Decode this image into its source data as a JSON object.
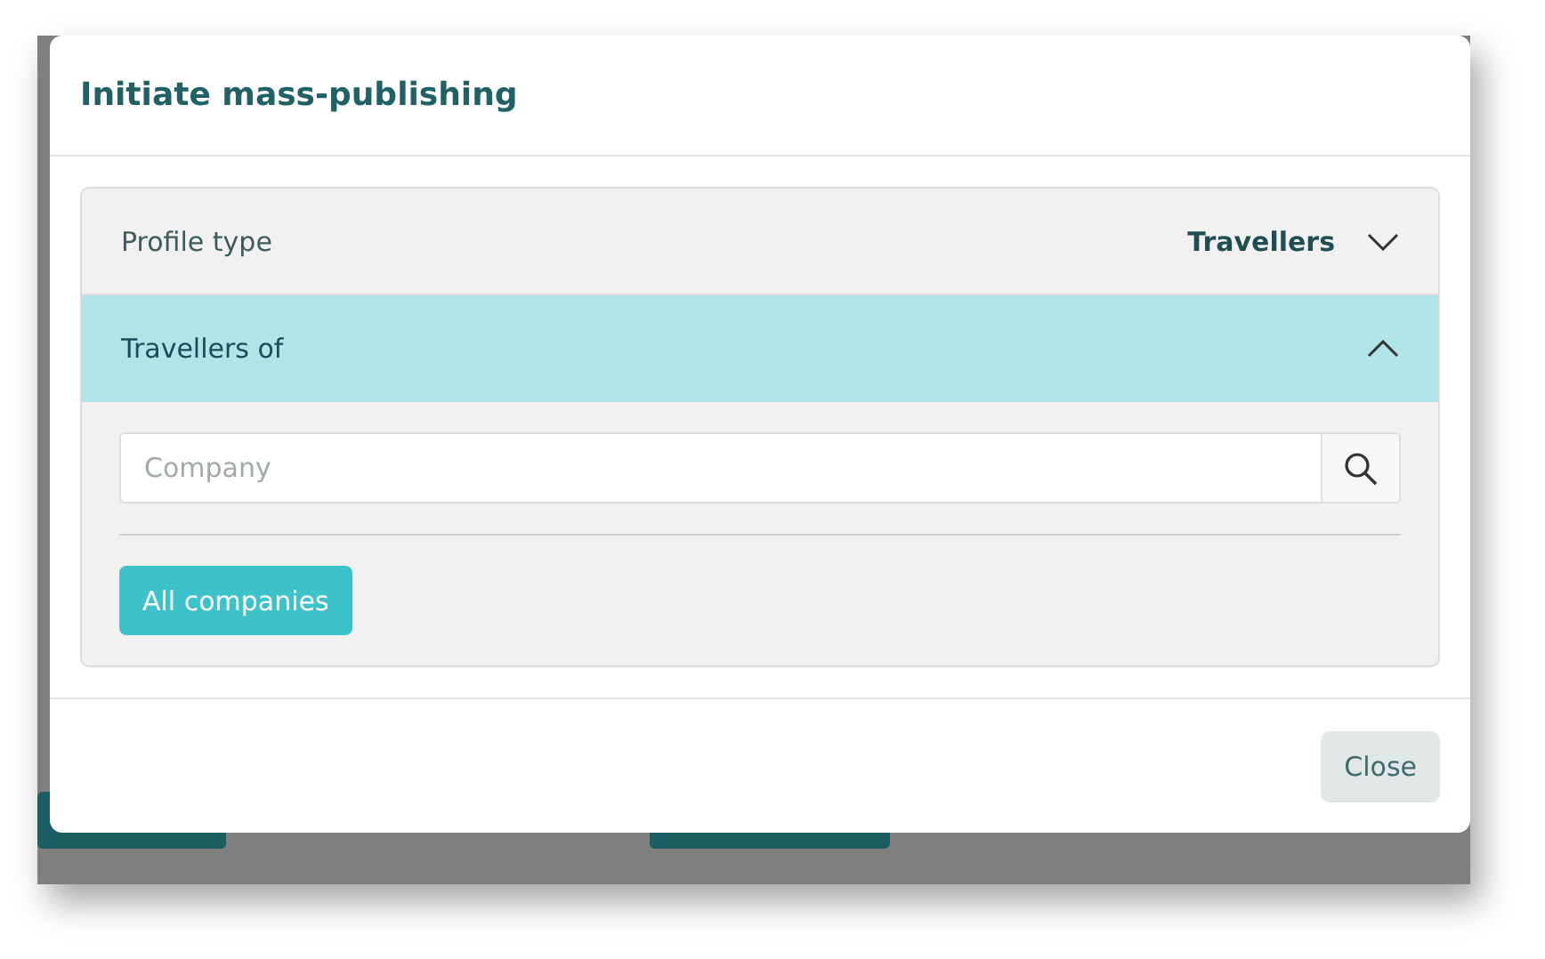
{
  "dialog": {
    "title": "Initiate mass-publishing"
  },
  "sections": [
    {
      "label": "Profile type",
      "value": "Travellers",
      "expanded": false
    },
    {
      "label": "Travellers of",
      "expanded": true
    }
  ],
  "search": {
    "placeholder": "Company"
  },
  "filter_button": "All companies",
  "footer_buttons": [
    "Close"
  ]
}
